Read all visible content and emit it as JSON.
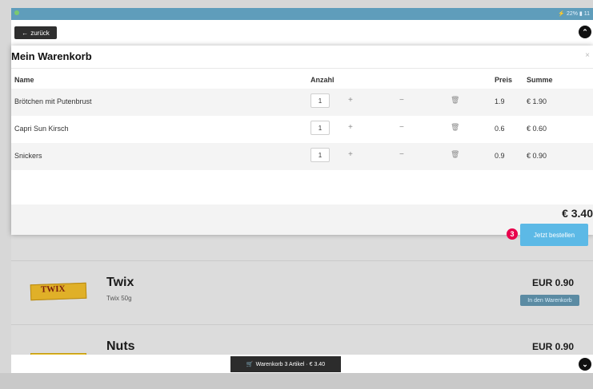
{
  "status_bar": {
    "text": "⚡ 22% ▮ 11"
  },
  "topbar": {
    "back_label": "zurück",
    "back_icon": "←",
    "up_icon": "⌃"
  },
  "modal": {
    "title": "Mein Warenkorb",
    "close": "×",
    "headers": {
      "name": "Name",
      "qty": "Anzahl",
      "price": "Preis",
      "sum": "Summe"
    },
    "rows": [
      {
        "name": "Brötchen mit Putenbrust",
        "qty": "1",
        "price": "1.9",
        "sum": "€ 1.90"
      },
      {
        "name": "Capri Sun Kirsch",
        "qty": "1",
        "price": "0.6",
        "sum": "€ 0.60"
      },
      {
        "name": "Snickers",
        "qty": "1",
        "price": "0.9",
        "sum": "€ 0.90"
      }
    ],
    "total": "€ 3.40",
    "order_label": "Jetzt bestellen",
    "badge": "3",
    "icons": {
      "plus": "+",
      "minus": "−",
      "trash": "🗑"
    }
  },
  "products": [
    {
      "name": "Twix",
      "sub": "Twix 50g",
      "price": "EUR 0.90",
      "add_label": "In den Warenkorb",
      "logo": "TWIX"
    },
    {
      "name": "Nuts",
      "price": "EUR 0.90"
    }
  ],
  "bottom": {
    "cart_label": "Warenkorb 3 Artikel · € 3.40",
    "cart_icon": "🛒",
    "down_icon": "⌄"
  }
}
